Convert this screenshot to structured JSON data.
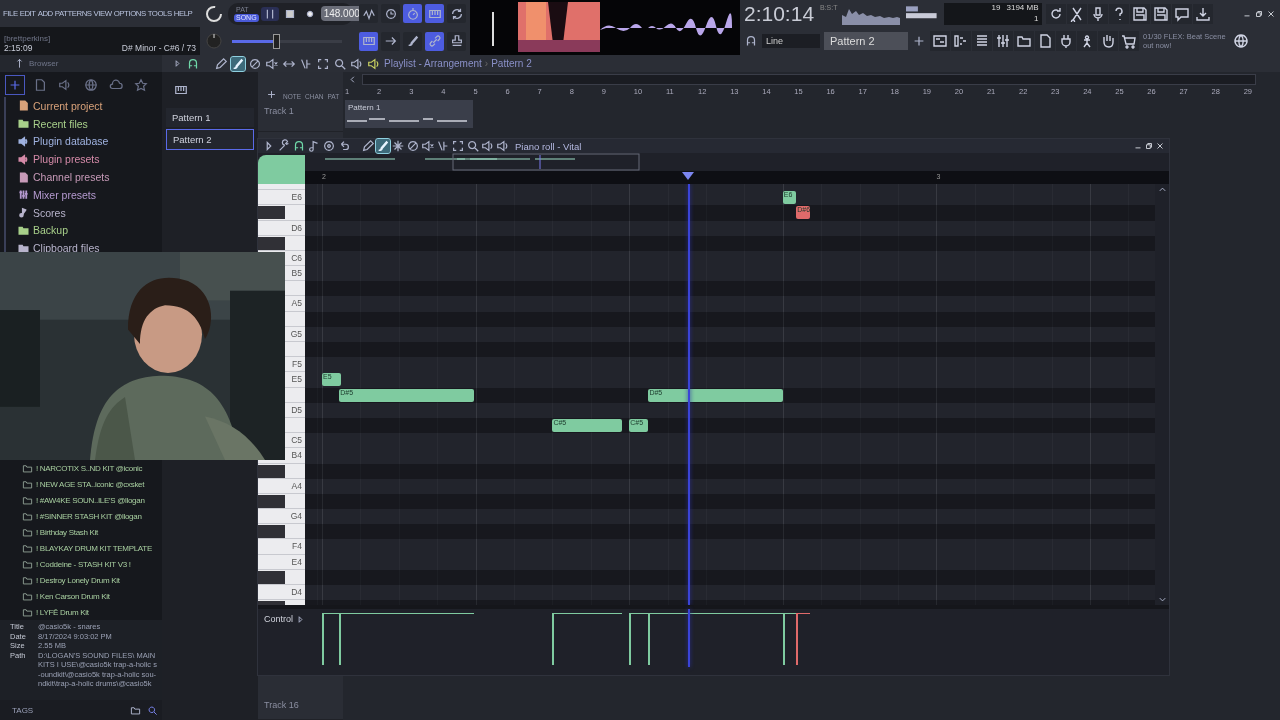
{
  "menu": [
    "FILE",
    "EDIT",
    "ADD",
    "PATTERNS",
    "VIEW",
    "OPTIONS",
    "TOOLS",
    "HELP"
  ],
  "hint": {
    "user": "[brettperkins]",
    "time": "2:15:09",
    "key": "D# Minor - C#6 / 73"
  },
  "transport": {
    "modes": [
      {
        "label": "PAT",
        "selected": false
      },
      {
        "label": "SONG",
        "selected": true
      }
    ],
    "tempo": "148.000",
    "master_volume": {
      "level": 0.4
    }
  },
  "top_tools": [
    {
      "on": false
    },
    {
      "on": false
    },
    {
      "on": true
    },
    {
      "on": true
    },
    {
      "on": false
    },
    {
      "on": true
    },
    {
      "on": false
    },
    {
      "on": false
    },
    {
      "on": true
    },
    {
      "on": false
    }
  ],
  "clock": {
    "time": "2:10:14",
    "unit": "B:S:T"
  },
  "cpu": {
    "value": "19",
    "memory": "3194 MB",
    "polyphony": "1"
  },
  "snap": "Line",
  "pattern": "Pattern 2",
  "news": {
    "count": "01/30",
    "text": "FLEX: Beat Scene out now!"
  },
  "browser": {
    "title": "Browser",
    "tabs": [
      {
        "selected": true
      },
      {
        "selected": false
      },
      {
        "selected": false
      },
      {
        "selected": false
      },
      {
        "selected": false
      },
      {
        "selected": false
      }
    ],
    "tree": [
      {
        "label": "Current project",
        "color": "#d9a27a"
      },
      {
        "label": "Recent files",
        "color": "#a8d08a"
      },
      {
        "label": "Plugin database",
        "color": "#9fb2e0"
      },
      {
        "label": "Plugin presets",
        "color": "#d58aa8"
      },
      {
        "label": "Channel presets",
        "color": "#c79ab8"
      },
      {
        "label": "Mixer presets",
        "color": "#b59ad0"
      },
      {
        "label": "Scores",
        "color": "#b8b4cc"
      },
      {
        "label": "Backup",
        "color": "#a8d08a"
      },
      {
        "label": "Clipboard files",
        "color": "#b8b4cc"
      }
    ],
    "kits": [
      "! NARCOTIX S..ND KIT @iconic",
      "! NEW AGE STA..iconic @cxsket",
      "! #AW4KE SOUN..ILE'S @llogan",
      "! #SINNER STASH KIT @llogan",
      "! Birthday Stash Kit",
      "! BLAYKAY DRUM KIT TEMPLATE",
      "! Coddeine - STASH KIT V3 !",
      "! Destroy Lonely Drum Kit",
      "! Ken Carson Drum Kit",
      "! LYFĒ Drum Kit"
    ],
    "info": [
      {
        "label": "Title",
        "value": "@casio5k - snares"
      },
      {
        "label": "Date",
        "value": "8/17/2024 9:03:02 PM"
      },
      {
        "label": "Size",
        "value": "2.55 MB"
      },
      {
        "label": "Path",
        "value": "D:\\LOGAN'S SOUND FILES\\ MAIN KITS I USE\\@casio5k trap-a-holic s-oundkit\\@casio5k trap-a-holic sou-ndkit\\trap-a-holic drums\\@casio5k"
      }
    ],
    "tags": "TAGS"
  },
  "patterns": [
    {
      "label": "Pattern 1",
      "selected": false
    },
    {
      "label": "Pattern 2",
      "selected": true
    }
  ],
  "playlist": {
    "title": "Playlist - Arrangement",
    "separator": "›",
    "pattern": "Pattern 2",
    "tools": [
      {
        "selected": false
      },
      {
        "selected": true
      },
      {
        "selected": false
      },
      {
        "selected": false
      },
      {
        "selected": false
      },
      {
        "selected": false
      },
      {
        "selected": false
      },
      {
        "selected": false
      },
      {
        "selected": false
      }
    ],
    "modes": [
      "NOTE",
      "CHAN",
      "PAT"
    ],
    "ruler": [
      "1",
      "2",
      "3",
      "4",
      "5",
      "6",
      "7",
      "8",
      "9",
      "10",
      "11",
      "12",
      "13",
      "14",
      "15",
      "16",
      "17",
      "18",
      "19",
      "20",
      "21",
      "22",
      "23",
      "24",
      "25",
      "26",
      "27",
      "28",
      "29"
    ],
    "tracks": [
      {
        "name": "Track 1",
        "clip": "Pattern 1"
      },
      {
        "name": "Track 16"
      }
    ]
  },
  "piano_roll": {
    "title": "Piano roll - Vital",
    "tools": [
      {
        "selected": false
      },
      {
        "selected": true
      },
      {
        "selected": false
      },
      {
        "selected": false
      },
      {
        "selected": false
      },
      {
        "selected": false
      },
      {
        "selected": false
      },
      {
        "selected": false
      },
      {
        "selected": false
      }
    ],
    "ruler": [
      "2",
      "3"
    ],
    "control": "Control",
    "keys": [
      {
        "kind": "white"
      },
      {
        "kind": "white",
        "label": "E6",
        "notes": [
          {
            "label": "E6",
            "color": "#7fcba0"
          }
        ]
      },
      {
        "kind": "black",
        "notes": [
          {
            "label": "D#6",
            "color": "#e06a6a"
          }
        ]
      },
      {
        "kind": "white",
        "label": "D6"
      },
      {
        "kind": "black"
      },
      {
        "kind": "white",
        "label": "C6"
      },
      {
        "kind": "white",
        "label": "B5"
      },
      {
        "kind": "black"
      },
      {
        "kind": "white",
        "label": "A5"
      },
      {
        "kind": "black"
      },
      {
        "kind": "white",
        "label": "G5"
      },
      {
        "kind": "black"
      },
      {
        "kind": "white",
        "label": "F5"
      },
      {
        "kind": "white",
        "label": "E5",
        "notes": [
          {
            "label": "E5",
            "color": "#7fcba0"
          }
        ]
      },
      {
        "kind": "black",
        "notes": [
          {
            "label": "D#5",
            "color": "#7fcba0"
          },
          {
            "label": "D#5",
            "color": "#7fcba0"
          }
        ]
      },
      {
        "kind": "white",
        "label": "D5"
      },
      {
        "kind": "black",
        "notes": [
          {
            "label": "C#5",
            "color": "#7fcba0"
          },
          {
            "label": "C#5",
            "color": "#7fcba0"
          }
        ]
      },
      {
        "kind": "white",
        "label": "C5"
      },
      {
        "kind": "white",
        "label": "B4"
      },
      {
        "kind": "black"
      },
      {
        "kind": "white",
        "label": "A4"
      },
      {
        "kind": "black"
      },
      {
        "kind": "white",
        "label": "G4"
      },
      {
        "kind": "black"
      },
      {
        "kind": "white",
        "label": "F4"
      },
      {
        "kind": "white",
        "label": "E4"
      },
      {
        "kind": "black"
      },
      {
        "kind": "white",
        "label": "D4"
      },
      {
        "kind": "black"
      }
    ]
  }
}
